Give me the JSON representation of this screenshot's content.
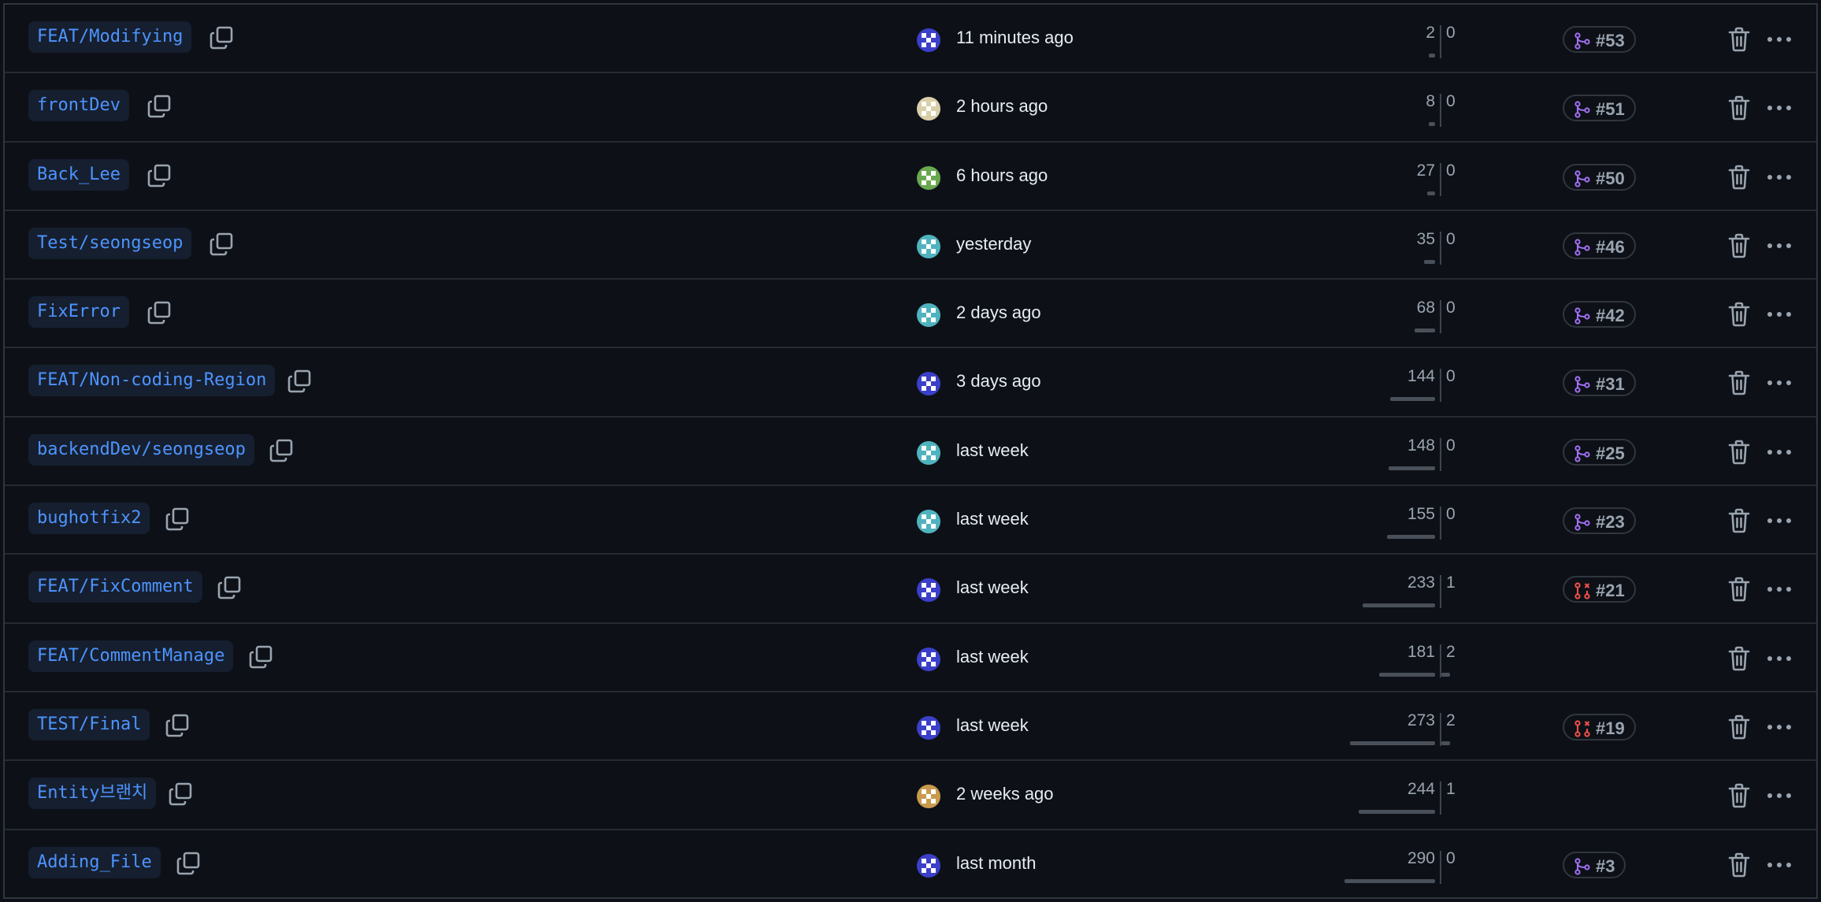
{
  "rows": [
    {
      "branch": "FEAT/Modifying",
      "avatar": "blue",
      "updated": "11 minutes ago",
      "behind": "2",
      "ahead": "0",
      "behind_frac": 0.01,
      "ahead_frac": 0.0,
      "pr": "#53",
      "pr_state": "merged"
    },
    {
      "branch": "frontDev",
      "avatar": "cream",
      "updated": "2 hours ago",
      "behind": "8",
      "ahead": "0",
      "behind_frac": 0.03,
      "ahead_frac": 0.0,
      "pr": "#51",
      "pr_state": "merged"
    },
    {
      "branch": "Back_Lee",
      "avatar": "green",
      "updated": "6 hours ago",
      "behind": "27",
      "ahead": "0",
      "behind_frac": 0.09,
      "ahead_frac": 0.0,
      "pr": "#50",
      "pr_state": "merged"
    },
    {
      "branch": "Test/seongseop",
      "avatar": "teal",
      "updated": "yesterday",
      "behind": "35",
      "ahead": "0",
      "behind_frac": 0.12,
      "ahead_frac": 0.0,
      "pr": "#46",
      "pr_state": "merged"
    },
    {
      "branch": "FixError",
      "avatar": "teal",
      "updated": "2 days ago",
      "behind": "68",
      "ahead": "0",
      "behind_frac": 0.23,
      "ahead_frac": 0.0,
      "pr": "#42",
      "pr_state": "merged"
    },
    {
      "branch": "FEAT/Non-coding-Region",
      "avatar": "blue",
      "updated": "3 days ago",
      "behind": "144",
      "ahead": "0",
      "behind_frac": 0.5,
      "ahead_frac": 0.0,
      "pr": "#31",
      "pr_state": "merged"
    },
    {
      "branch": "backendDev/seongseop",
      "avatar": "teal",
      "updated": "last week",
      "behind": "148",
      "ahead": "0",
      "behind_frac": 0.51,
      "ahead_frac": 0.0,
      "pr": "#25",
      "pr_state": "merged"
    },
    {
      "branch": "bughotfix2",
      "avatar": "teal",
      "updated": "last week",
      "behind": "155",
      "ahead": "0",
      "behind_frac": 0.53,
      "ahead_frac": 0.0,
      "pr": "#23",
      "pr_state": "merged"
    },
    {
      "branch": "FEAT/FixComment",
      "avatar": "blue",
      "updated": "last week",
      "behind": "233",
      "ahead": "1",
      "behind_frac": 0.8,
      "ahead_frac": 0.003,
      "pr": "#21",
      "pr_state": "closed"
    },
    {
      "branch": "FEAT/CommentManage",
      "avatar": "blue",
      "updated": "last week",
      "behind": "181",
      "ahead": "2",
      "behind_frac": 0.62,
      "ahead_frac": 0.14,
      "pr": "",
      "pr_state": "none"
    },
    {
      "branch": "TEST/Final",
      "avatar": "blue",
      "updated": "last week",
      "behind": "273",
      "ahead": "2",
      "behind_frac": 0.94,
      "ahead_frac": 0.14,
      "pr": "#19",
      "pr_state": "closed"
    },
    {
      "branch": "Entity브랜치",
      "avatar": "tan",
      "updated": "2 weeks ago",
      "behind": "244",
      "ahead": "1",
      "behind_frac": 0.84,
      "ahead_frac": 0.003,
      "pr": "",
      "pr_state": "none"
    },
    {
      "branch": "Adding_File",
      "avatar": "blue",
      "updated": "last month",
      "behind": "290",
      "ahead": "0",
      "behind_frac": 1.0,
      "ahead_frac": 0.0,
      "pr": "#3",
      "pr_state": "merged"
    }
  ],
  "colors": {
    "merged": "#a371f7",
    "closed": "#f85149",
    "branch_text": "#4d94ff"
  },
  "icons": {
    "copy": "copy-icon",
    "trash": "trash-icon",
    "more": "kebab-horizontal-icon",
    "merged": "git-merge-icon",
    "closed": "git-pull-request-closed-icon"
  }
}
